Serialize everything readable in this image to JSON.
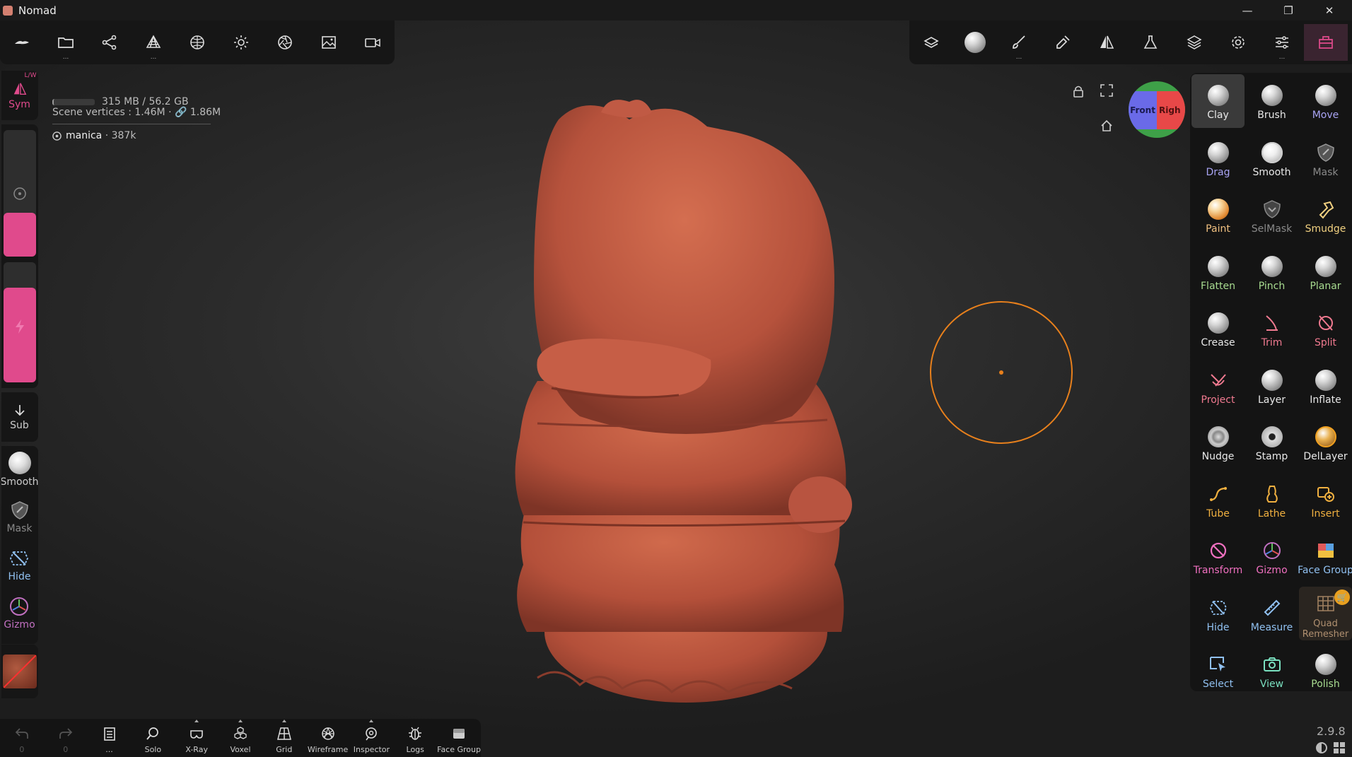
{
  "window": {
    "title": "Nomad",
    "minimize": "—",
    "restore": "❐",
    "close": "✕"
  },
  "scene": {
    "memory": "315 MB / 56.2 GB",
    "vertices": "Scene vertices : 1.46M · 🔗 1.86M",
    "object": "manica",
    "object_count": "· 387k"
  },
  "top_left_toolbar": [
    "nomad-icon",
    "folder-icon",
    "scene-graph-icon",
    "mesh-icon",
    "material-icon",
    "light-icon",
    "aperture-icon",
    "image-icon",
    "camera-icon"
  ],
  "top_right_toolbar": [
    "layers-3d-icon",
    "material-sphere-icon",
    "paint-brush-icon",
    "dropper-icon",
    "symmetry-icon",
    "flask-icon",
    "layers-icon",
    "settings-icon",
    "sliders-icon",
    "tools-panel-icon"
  ],
  "viewport": {
    "cube_front": "Front",
    "cube_right": "Righ"
  },
  "left_panel": {
    "sym": "Sym",
    "sym_tag": "L/W",
    "sub": "Sub",
    "smooth": "Smooth",
    "mask": "Mask",
    "hide": "Hide",
    "gizmo": "Gizmo"
  },
  "tools": [
    {
      "label": "Clay",
      "color": "#e8e8e8",
      "active": true
    },
    {
      "label": "Brush",
      "color": "#e8e8e8"
    },
    {
      "label": "Move",
      "color": "#a9a4f4"
    },
    {
      "label": "Drag",
      "color": "#a9a4f4"
    },
    {
      "label": "Smooth",
      "color": "#e8e8e8"
    },
    {
      "label": "Mask",
      "color": "#8a8a8a"
    },
    {
      "label": "Paint",
      "color": "#f0c080"
    },
    {
      "label": "SelMask",
      "color": "#8a8a8a"
    },
    {
      "label": "Smudge",
      "color": "#f0d080"
    },
    {
      "label": "Flatten",
      "color": "#a8dc90"
    },
    {
      "label": "Pinch",
      "color": "#a8dc90"
    },
    {
      "label": "Planar",
      "color": "#a8dc90"
    },
    {
      "label": "Crease",
      "color": "#e8e8e8"
    },
    {
      "label": "Trim",
      "color": "#f07a90"
    },
    {
      "label": "Split",
      "color": "#f07a90"
    },
    {
      "label": "Project",
      "color": "#f07a90"
    },
    {
      "label": "Layer",
      "color": "#e8e8e8"
    },
    {
      "label": "Inflate",
      "color": "#e8e8e8"
    },
    {
      "label": "Nudge",
      "color": "#e8e8e8"
    },
    {
      "label": "Stamp",
      "color": "#e8e8e8"
    },
    {
      "label": "DelLayer",
      "color": "#e8e8e8"
    },
    {
      "label": "Tube",
      "color": "#f0b040"
    },
    {
      "label": "Lathe",
      "color": "#f0b040"
    },
    {
      "label": "Insert",
      "color": "#f0b040"
    },
    {
      "label": "Transform",
      "color": "#f070c0"
    },
    {
      "label": "Gizmo",
      "color": "#f070c0"
    },
    {
      "label": "Face Group",
      "color": "#90c0f0"
    },
    {
      "label": "Hide",
      "color": "#90c0f0"
    },
    {
      "label": "Measure",
      "color": "#90c0f0"
    },
    {
      "label": "Quad Remesher",
      "color": "#b09070"
    },
    {
      "label": "Select",
      "color": "#90c0f0"
    },
    {
      "label": "View",
      "color": "#7ae0c0"
    },
    {
      "label": "Polish",
      "color": "#a8dc90"
    }
  ],
  "bottom_bar": [
    {
      "label": "0",
      "icon": "undo-icon"
    },
    {
      "label": "0",
      "icon": "redo-icon"
    },
    {
      "label": "...",
      "icon": "notes-icon"
    },
    {
      "label": "Solo",
      "icon": "search-icon"
    },
    {
      "label": "X-Ray",
      "icon": "xray-icon"
    },
    {
      "label": "Voxel",
      "icon": "voxel-icon"
    },
    {
      "label": "Grid",
      "icon": "grid-icon"
    },
    {
      "label": "Wireframe",
      "icon": "wireframe-icon"
    },
    {
      "label": "Inspector",
      "icon": "inspector-icon"
    },
    {
      "label": "Logs",
      "icon": "bug-icon"
    },
    {
      "label": "Face Group",
      "icon": "face-group-icon"
    }
  ],
  "version": "2.9.8"
}
